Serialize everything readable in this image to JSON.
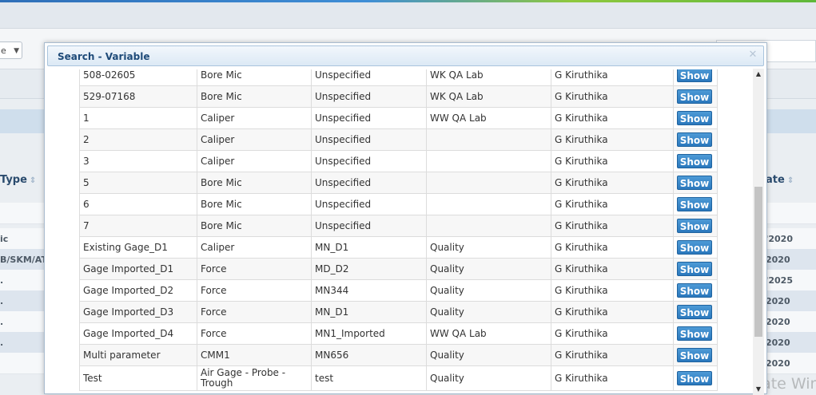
{
  "background": {
    "select_value": "e",
    "col_type_header": "Type",
    "col_date_header": "ate",
    "left_cells": [
      "ic",
      "B/SKM/AT",
      ".",
      ".",
      ".",
      "."
    ],
    "right_cells": [
      "'2020",
      "2020",
      "'2025",
      "2020",
      "2020",
      "2020",
      "2020"
    ],
    "watermark": "Activate Windows"
  },
  "dialog": {
    "title": "Search - Variable",
    "close_icon": "close-icon"
  },
  "table": {
    "button_label": "Show",
    "rows": [
      {
        "name": "508-02605",
        "type": "Bore Mic",
        "model": "Unspecified",
        "location": "WK QA Lab",
        "owner": "G Kiruthika"
      },
      {
        "name": "529-07168",
        "type": "Bore Mic",
        "model": "Unspecified",
        "location": "WK QA Lab",
        "owner": "G Kiruthika"
      },
      {
        "name": "1",
        "type": "Caliper",
        "model": "Unspecified",
        "location": "WW QA Lab",
        "owner": "G Kiruthika"
      },
      {
        "name": "2",
        "type": "Caliper",
        "model": "Unspecified",
        "location": "",
        "owner": "G Kiruthika"
      },
      {
        "name": "3",
        "type": "Caliper",
        "model": "Unspecified",
        "location": "",
        "owner": "G Kiruthika"
      },
      {
        "name": "5",
        "type": "Bore Mic",
        "model": "Unspecified",
        "location": "",
        "owner": "G Kiruthika"
      },
      {
        "name": "6",
        "type": "Bore Mic",
        "model": "Unspecified",
        "location": "",
        "owner": "G Kiruthika"
      },
      {
        "name": "7",
        "type": "Bore Mic",
        "model": "Unspecified",
        "location": "",
        "owner": "G Kiruthika"
      },
      {
        "name": "Existing Gage_D1",
        "type": "Caliper",
        "model": "MN_D1",
        "location": "Quality",
        "owner": "G Kiruthika"
      },
      {
        "name": "Gage Imported_D1",
        "type": "Force",
        "model": "MD_D2",
        "location": "Quality",
        "owner": "G Kiruthika"
      },
      {
        "name": "Gage Imported_D2",
        "type": "Force",
        "model": "MN344",
        "location": "Quality",
        "owner": "G Kiruthika"
      },
      {
        "name": "Gage Imported_D3",
        "type": "Force",
        "model": "MN_D1",
        "location": "Quality",
        "owner": "G Kiruthika"
      },
      {
        "name": "Gage Imported_D4",
        "type": "Force",
        "model": "MN1_Imported",
        "location": "WW QA Lab",
        "owner": "G Kiruthika"
      },
      {
        "name": "Multi parameter",
        "type": "CMM1",
        "model": "MN656",
        "location": "Quality",
        "owner": "G Kiruthika"
      },
      {
        "name": "Test",
        "type": "Air Gage - Probe - Trough",
        "model": "test",
        "location": "Quality",
        "owner": "G Kiruthika"
      }
    ]
  },
  "scrollbar": {
    "up_icon": "scroll-up-arrow-icon",
    "down_icon": "scroll-down-arrow-icon"
  }
}
